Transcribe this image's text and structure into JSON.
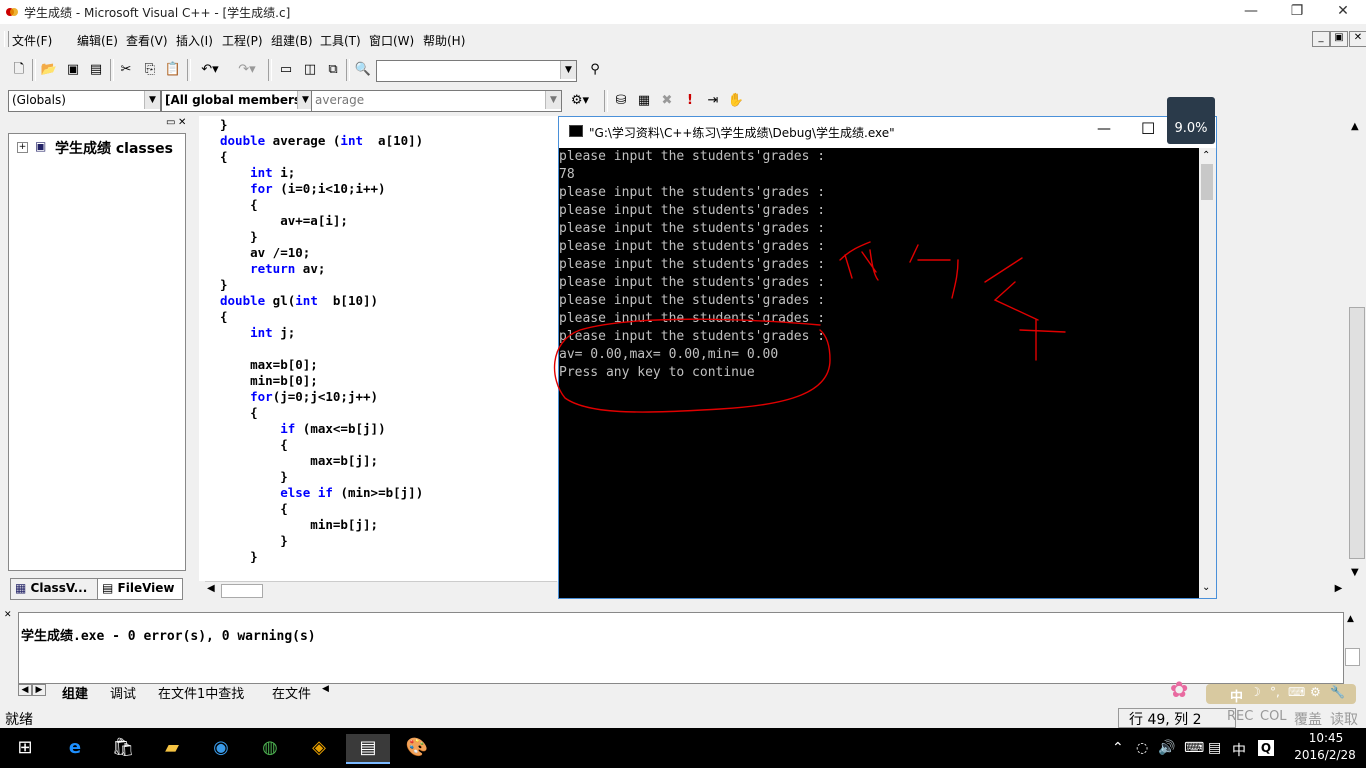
{
  "window": {
    "title": "学生成绩 - Microsoft Visual C++ - [学生成绩.c]",
    "minimize": "—",
    "restore": "❐",
    "close": "✕"
  },
  "menu": [
    "文件(F)",
    "编辑(E)",
    "查看(V)",
    "插入(I)",
    "工程(P)",
    "组建(B)",
    "工具(T)",
    "窗口(W)",
    "帮助(H)"
  ],
  "mdi_buttons": [
    "_",
    "▣",
    "✕"
  ],
  "wizard_bar": {
    "globals": "(Globals)",
    "members": "[All global members",
    "function": "average"
  },
  "left_panel": {
    "tree_root": "学生成绩 classes",
    "tab_classview": "ClassV...",
    "tab_fileview": "FileView"
  },
  "code_lines": [
    "}",
    "double average (int  a[10])",
    "{",
    "    int i;",
    "    for (i=0;i<10;i++)",
    "    {",
    "        av+=a[i];",
    "    }",
    "    av /=10;",
    "    return av;",
    "}",
    "double gl(int  b[10])",
    "{",
    "    int j;",
    "",
    "    max=b[0];",
    "    min=b[0];",
    "    for(j=0;j<10;j++)",
    "    {",
    "        if (max<=b[j])",
    "        {",
    "            max=b[j];",
    "        }",
    "        else if (min>=b[j])",
    "        {",
    "            min=b[j];",
    "        }",
    "    }"
  ],
  "console": {
    "title": "\"G:\\学习资料\\C++练习\\学生成绩\\Debug\\学生成绩.exe\"",
    "lines": [
      "please input the students'grades :",
      "78",
      "please input the students'grades :",
      "please input the students'grades :",
      "please input the students'grades :",
      "please input the students'grades :",
      "please input the students'grades :",
      "please input the students'grades :",
      "please input the students'grades :",
      "please input the students'grades :",
      "please input the students'grades :",
      "av= 0.00,max= 0.00,min= 0.00",
      "Press any key to continue"
    ]
  },
  "zoom_badge": "9.0%",
  "output": {
    "message": "学生成绩.exe - 0 error(s), 0 warning(s)",
    "tabs": [
      "组建",
      "调试",
      "在文件1中查找",
      "在文件"
    ]
  },
  "status": {
    "ready": "就绪",
    "position": "行 49, 列 2",
    "rec": "REC",
    "col": "COL",
    "ovr": "覆盖",
    "read": "读取"
  },
  "ime_bar": "中",
  "taskbar": {
    "time": "10:45",
    "date": "2016/2/28",
    "ime": "中"
  },
  "colors": {
    "keyword": "#0000ff",
    "console_bg": "#000000",
    "console_fg": "#c0c0c0",
    "annotation": "#e00000"
  }
}
